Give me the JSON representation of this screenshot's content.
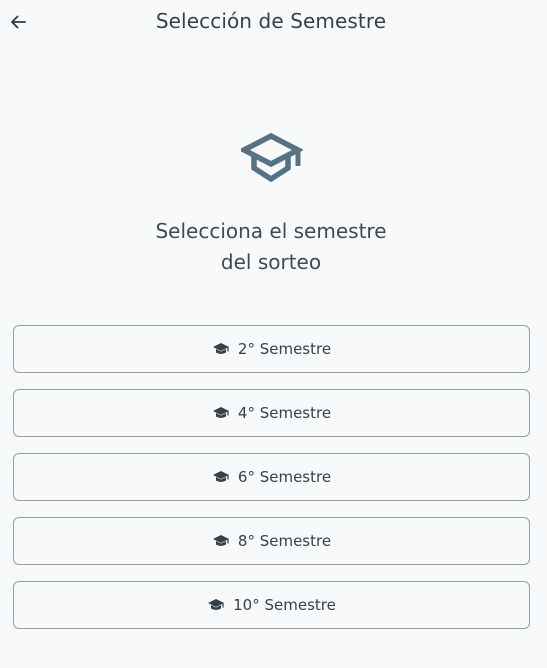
{
  "app_bar": {
    "back_icon": "arrow-left-icon",
    "title": "Selección de Semestre"
  },
  "hero": {
    "icon": "graduation-cap-icon",
    "icon_color": "#567383",
    "subtitle_line1": "Selecciona el semestre",
    "subtitle_line2": "del sorteo"
  },
  "options": [
    {
      "label": "2° Semestre",
      "icon": "graduation-cap-icon"
    },
    {
      "label": "4° Semestre",
      "icon": "graduation-cap-icon"
    },
    {
      "label": "6° Semestre",
      "icon": "graduation-cap-icon"
    },
    {
      "label": "8° Semestre",
      "icon": "graduation-cap-icon"
    },
    {
      "label": "10° Semestre",
      "icon": "graduation-cap-icon"
    }
  ],
  "colors": {
    "background": "#f8f9fa",
    "border": "#8fa1ad",
    "text": "#36414a"
  }
}
